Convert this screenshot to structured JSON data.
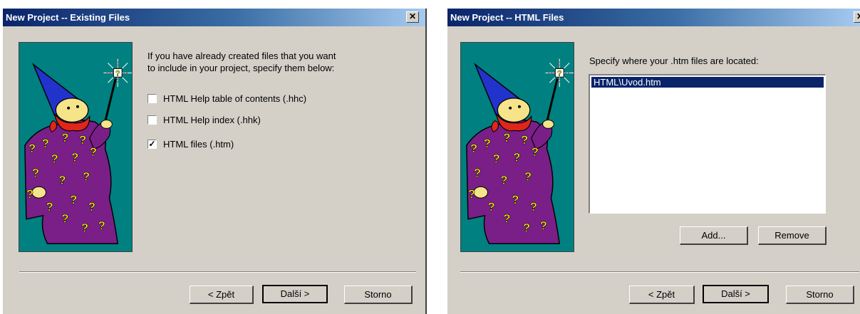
{
  "dialog1": {
    "title": "New Project -- Existing Files",
    "close_glyph": "✕",
    "wizard_image": "wizard-illustration",
    "instructions_line1": "If you have already created files that you want",
    "instructions_line2": "to include in your project, specify them below:",
    "checkboxes": [
      {
        "label": "HTML Help table of contents (.hhc)",
        "checked": false
      },
      {
        "label": "HTML Help index (.hhk)",
        "checked": false
      },
      {
        "label": "HTML files (.htm)",
        "checked": true
      }
    ],
    "check_glyph": "✓",
    "back_label": "< Zpět",
    "next_label": "Další >",
    "cancel_label": "Storno"
  },
  "dialog2": {
    "title": "New Project -- HTML Files",
    "close_glyph": "✕",
    "wizard_image": "wizard-illustration",
    "instructions": "Specify where your .htm files are located:",
    "files": [
      "HTML\\Uvod.htm"
    ],
    "add_label": "Add...",
    "remove_label": "Remove",
    "back_label": "< Zpět",
    "next_label": "Další >",
    "cancel_label": "Storno"
  },
  "colors": {
    "titlebar_start": "#0a246a",
    "titlebar_end": "#a6caf0",
    "dialog_bg": "#d4d0c8",
    "wizard_bg": "#008080",
    "robe": "#7a1f87",
    "hat": "#2233cc",
    "beard": "#e0261a",
    "face": "#f5e48a",
    "question_mark": "#ffff00"
  }
}
